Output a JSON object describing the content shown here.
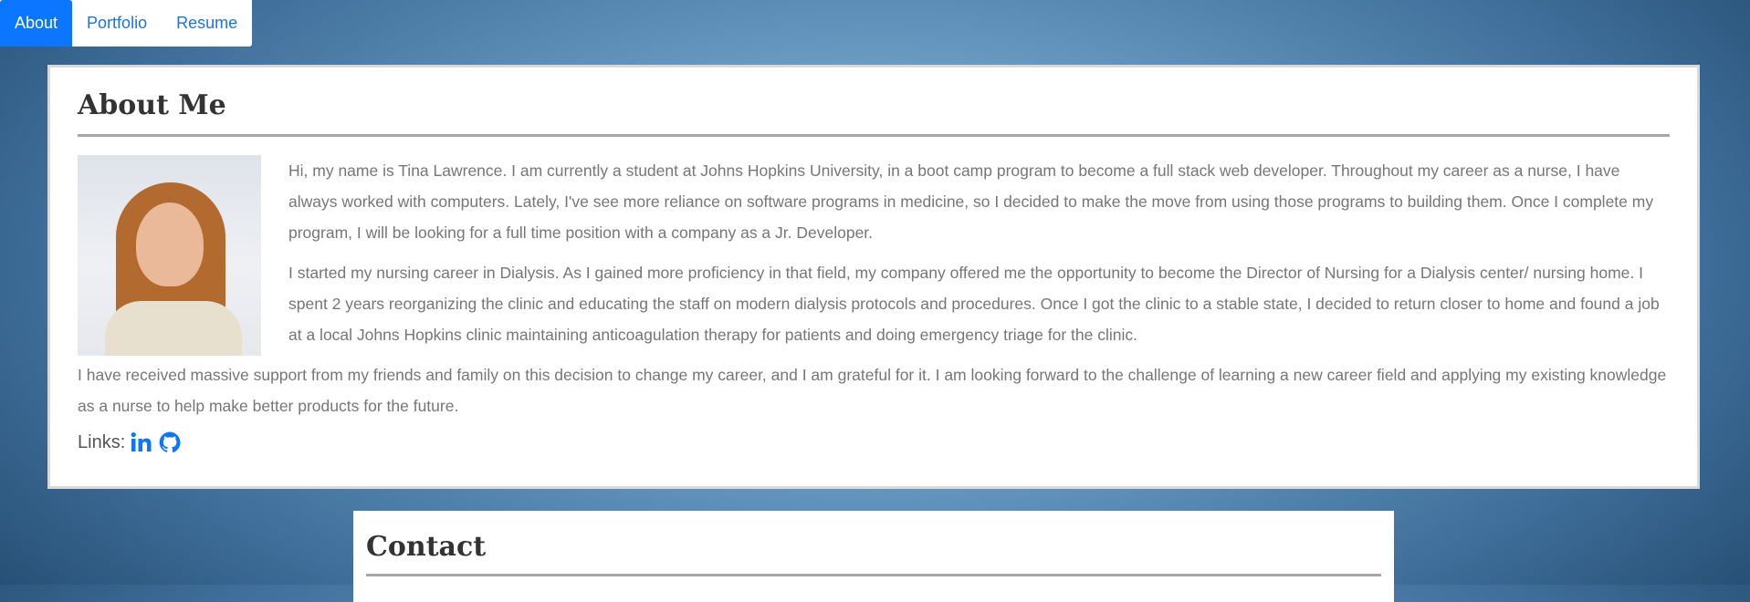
{
  "nav": {
    "tabs": [
      {
        "label": "About"
      },
      {
        "label": "Portfolio"
      },
      {
        "label": "Resume"
      }
    ]
  },
  "about": {
    "title": "About Me",
    "paragraphs": [
      "Hi, my name is Tina Lawrence. I am currently a student at Johns Hopkins University, in a boot camp program to become a full stack web developer. Throughout my career as a nurse, I have always worked with computers. Lately, I've see more reliance on software programs in medicine, so I decided to make the move from using those programs to building them. Once I complete my program, I will be looking for a full time position with a company as a Jr. Developer.",
      "I started my nursing career in Dialysis. As I gained more proficiency in that field, my company offered me the opportunity to become the Director of Nursing for a Dialysis center/ nursing home. I spent 2 years reorganizing the clinic and educating the staff on modern dialysis protocols and procedures. Once I got the clinic to a stable state, I decided to return closer to home and found a job at a local Johns Hopkins clinic maintaining anticoagulation therapy for patients and doing emergency triage for the clinic.",
      "I have received massive support from my friends and family on this decision to change my career, and I am grateful for it. I am looking forward to the challenge of learning a new career field and applying my existing knowledge as a nurse to help make better products for the future."
    ],
    "links_label": "Links:",
    "link_icons": [
      "linkedin-icon",
      "github-icon"
    ]
  },
  "contact": {
    "title": "Contact"
  },
  "colors": {
    "accent": "#0b76ff",
    "link": "#1a73e8",
    "body_text": "#767676"
  }
}
